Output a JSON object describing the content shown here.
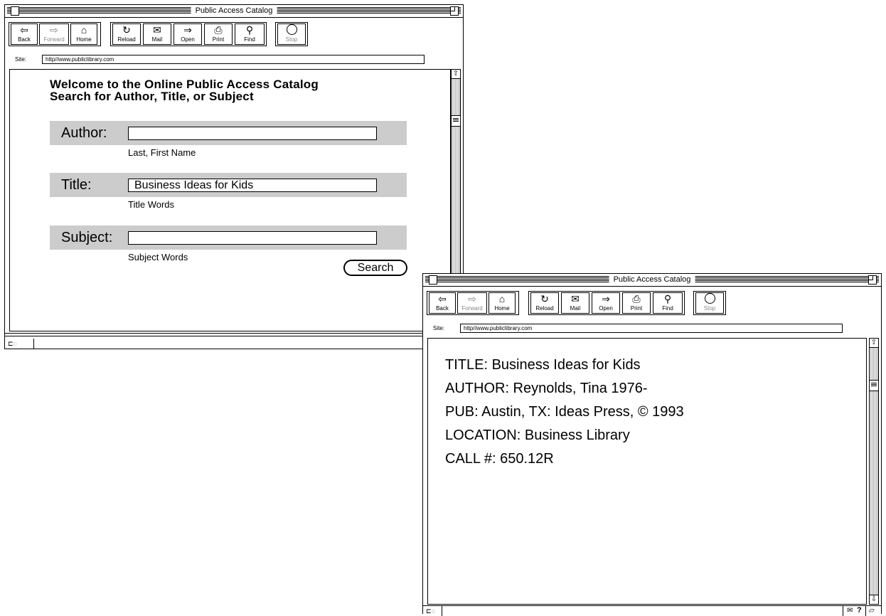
{
  "windows": [
    {
      "title": "Public Access Catalog",
      "toolbar": {
        "back": "Back",
        "forward": "Forward",
        "home": "Home",
        "reload": "Reload",
        "mail": "Mail",
        "open": "Open",
        "print": "Print",
        "find": "Find",
        "stop": "Stop"
      },
      "site": {
        "label": "Site:",
        "url": "http//www.publiclibrary.com"
      },
      "page": {
        "heading_line1": "Welcome to the Online Public Access Catalog",
        "heading_line2": "Search for Author, Title, or Subject",
        "author": {
          "label": "Author:",
          "value": "",
          "hint": "Last, First Name"
        },
        "title": {
          "label": "Title:",
          "value": "Business Ideas for Kids",
          "hint": "Title Words"
        },
        "subject": {
          "label": "Subject:",
          "value": "",
          "hint": "Subject Words"
        },
        "search_button": "Search"
      }
    },
    {
      "title": "Public Access Catalog",
      "toolbar": {
        "back": "Back",
        "forward": "Forward",
        "home": "Home",
        "reload": "Reload",
        "mail": "Mail",
        "open": "Open",
        "print": "Print",
        "find": "Find",
        "stop": "Stop"
      },
      "site": {
        "label": "Site:",
        "url": "http//www.publiclibrary.com"
      },
      "record": {
        "title_line": "TITLE: Business Ideas for Kids",
        "author_line": "AUTHOR: Reynolds, Tina 1976-",
        "pub_line": "PUB: Austin, TX: Ideas Press, © 1993",
        "location_line": "LOCATION: Business Library",
        "call_line": "CALL #: 650.12R"
      },
      "status_right": "?"
    }
  ]
}
